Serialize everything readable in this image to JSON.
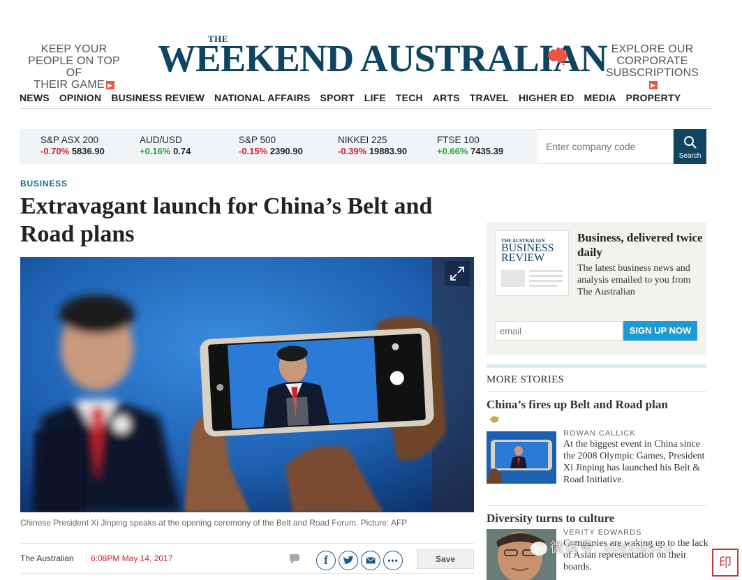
{
  "header": {
    "promo_left": [
      "KEEP YOUR",
      "PEOPLE ON TOP OF",
      "THEIR GAME"
    ],
    "promo_right": [
      "EXPLORE OUR",
      "CORPORATE",
      "SUBSCRIPTIONS"
    ],
    "masthead_the": "THE",
    "masthead_name": "WEEKEND AUSTRALIAN",
    "brand_color": "#0f4560"
  },
  "nav": [
    "NEWS",
    "OPINION",
    "BUSINESS REVIEW",
    "NATIONAL AFFAIRS",
    "SPORT",
    "LIFE",
    "TECH",
    "ARTS",
    "TRAVEL",
    "HIGHER ED",
    "MEDIA",
    "PROPERTY"
  ],
  "market": {
    "tickers": [
      {
        "name": "S&P ASX 200",
        "change": "-0.70%",
        "value": "5836.90",
        "dir": "neg"
      },
      {
        "name": "AUD/USD",
        "change": "+0.16%",
        "value": "0.74",
        "dir": "pos"
      },
      {
        "name": "S&P 500",
        "change": "-0.15%",
        "value": "2390.90",
        "dir": "neg"
      },
      {
        "name": "NIKKEI 225",
        "change": "-0.39%",
        "value": "19883.90",
        "dir": "neg"
      },
      {
        "name": "FTSE 100",
        "change": "+0.66%",
        "value": "7435.39",
        "dir": "pos"
      }
    ],
    "search_placeholder": "Enter company code",
    "search_label": "Search"
  },
  "article": {
    "section": "BUSINESS",
    "headline": "Extravagant launch for China’s Belt and Road plans",
    "caption": "Chinese President Xi Jinping speaks at the opening ceremony of the Belt and Road Forum. Picture: AFP",
    "byline": "The Australian",
    "date": "6:08PM May 14, 2017",
    "save_label": "Save"
  },
  "sidebar": {
    "promo": {
      "thumb_the": "THE AUSTRALIAN",
      "thumb_title_1": "BUSINESS",
      "thumb_title_2": "REVIEW",
      "title": "Business, delivered twice daily",
      "desc": "The latest business news and analysis emailed to you from The Australian",
      "email_placeholder": "email",
      "signup_label": "SIGN UP NOW"
    },
    "more_title": "MORE STORIES",
    "stories": [
      {
        "title": "China’s fires up Belt and Road plan",
        "author": "ROWAN CALLICK",
        "text": "At the biggest event in China since the 2008 Olympic Games, President Xi Jinping has launched his Belt & Road Initiative."
      },
      {
        "title": "Diversity turns to culture",
        "author": "VERITY EDWARDS",
        "text": "Companies are waking up to the lack of Asian representation on their boards."
      }
    ]
  },
  "watermark": {
    "text": "微信号: xuexiaozu"
  }
}
